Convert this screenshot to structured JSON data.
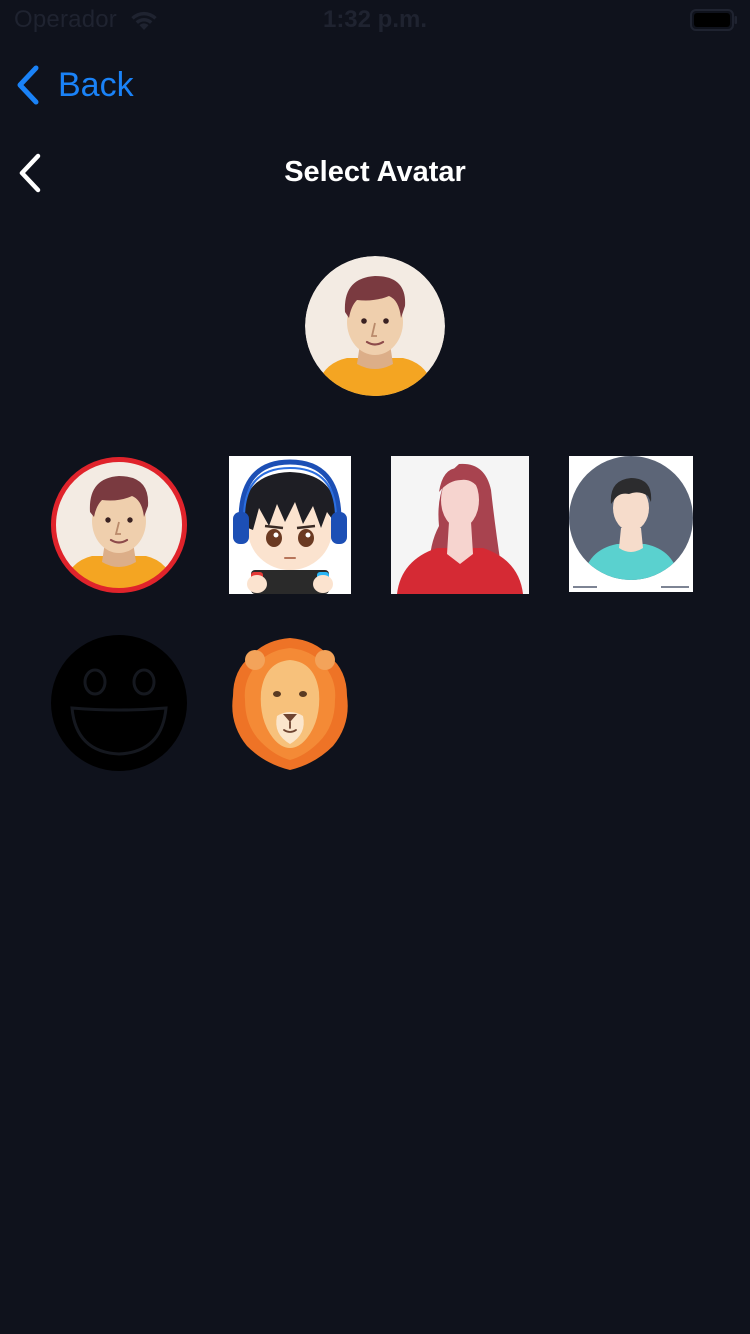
{
  "status_bar": {
    "carrier": "Operador",
    "time": "1:32 p.m.",
    "icons": [
      "wifi-icon",
      "battery-icon"
    ]
  },
  "nav": {
    "back_label": "Back",
    "back_icon": "chevron-left-icon"
  },
  "header": {
    "title": "Select Avatar",
    "back_icon": "chevron-left-icon"
  },
  "selected_avatar": "man-cartoon-avatar",
  "avatars": [
    {
      "name": "man-cartoon-avatar",
      "selected": true
    },
    {
      "name": "anime-gamer-avatar",
      "selected": false
    },
    {
      "name": "woman-silhouette-avatar",
      "selected": false
    },
    {
      "name": "person-silhouette-avatar",
      "selected": false
    },
    {
      "name": "smiley-face-avatar",
      "selected": false
    },
    {
      "name": "lion-avatar",
      "selected": false
    }
  ],
  "colors": {
    "background": "#0f121c",
    "accent_blue": "#1a82f7",
    "selection_ring": "#e0232b",
    "text": "#ffffff"
  }
}
